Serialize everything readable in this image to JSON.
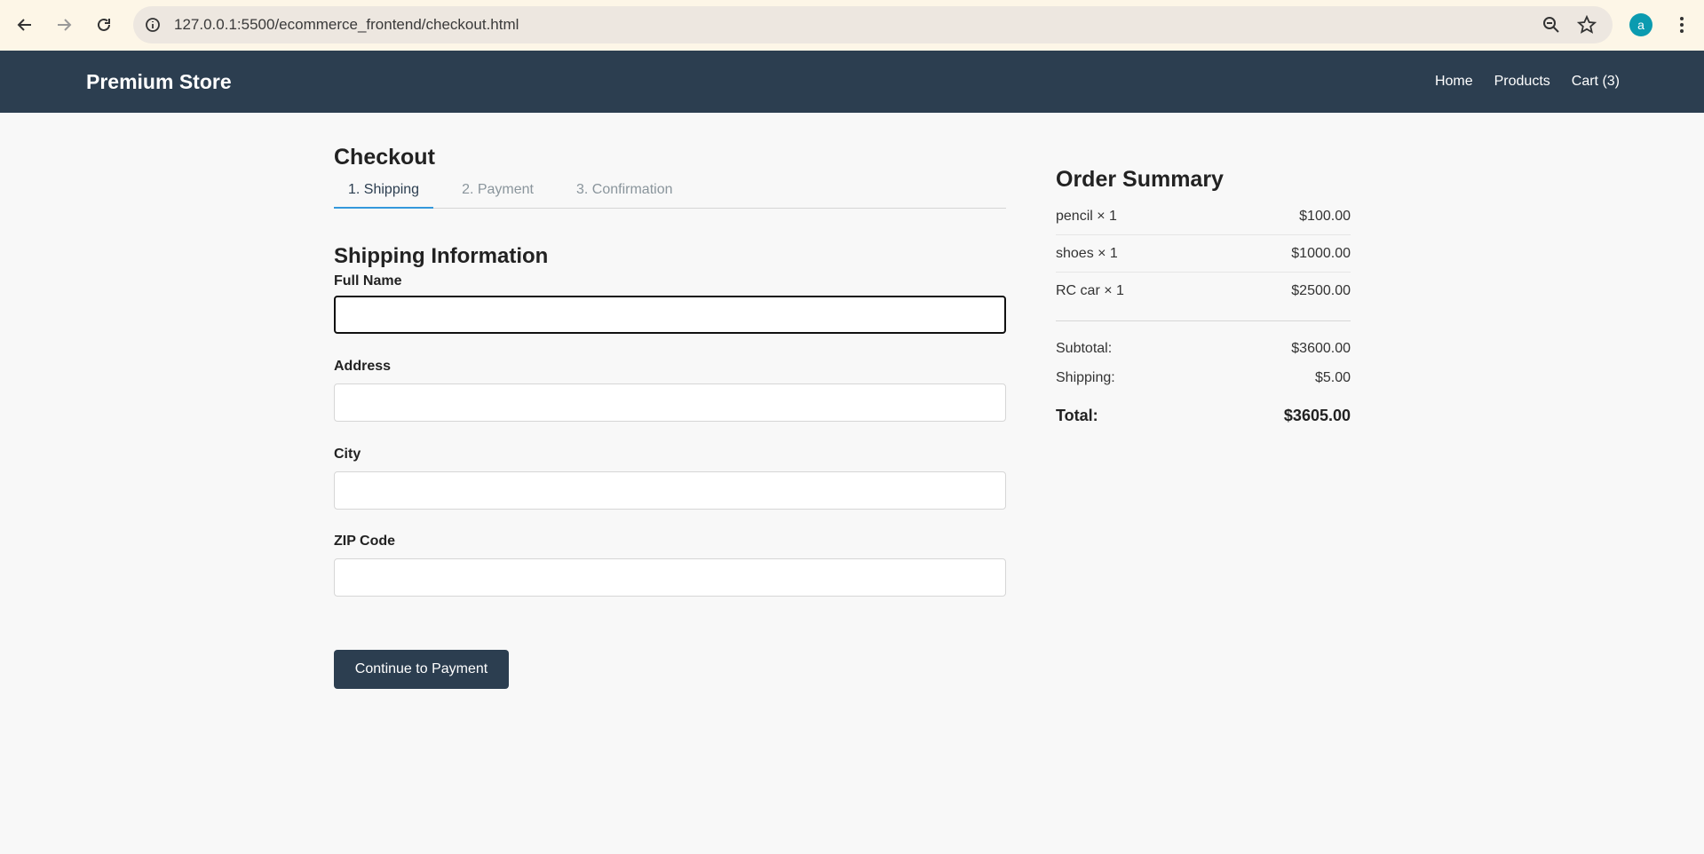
{
  "browser": {
    "url": "127.0.0.1:5500/ecommerce_frontend/checkout.html",
    "profile_initial": "a",
    "icons": [
      "back-arrow-icon",
      "forward-arrow-icon",
      "reload-icon",
      "site-info-icon",
      "zoom-icon",
      "bookmark-star-icon",
      "more-vert-icon"
    ]
  },
  "header": {
    "brand": "Premium Store",
    "nav": {
      "home": "Home",
      "products": "Products",
      "cart": "Cart (3)"
    }
  },
  "checkout": {
    "title": "Checkout",
    "steps": {
      "shipping": "1. Shipping",
      "payment": "2. Payment",
      "confirmation": "3. Confirmation"
    },
    "section_title": "Shipping Information",
    "fields": {
      "full_name": {
        "label": "Full Name",
        "value": ""
      },
      "address": {
        "label": "Address",
        "value": ""
      },
      "city": {
        "label": "City",
        "value": ""
      },
      "zip": {
        "label": "ZIP Code",
        "value": ""
      }
    },
    "continue_label": "Continue to Payment"
  },
  "summary": {
    "title": "Order Summary",
    "items": [
      {
        "name": "pencil × 1",
        "price": "$100.00"
      },
      {
        "name": "shoes × 1",
        "price": "$1000.00"
      },
      {
        "name": "RC car × 1",
        "price": "$2500.00"
      }
    ],
    "subtotal_label": "Subtotal:",
    "subtotal_value": "$3600.00",
    "shipping_label": "Shipping:",
    "shipping_value": "$5.00",
    "total_label": "Total:",
    "total_value": "$3605.00"
  },
  "colors": {
    "header_bg": "#2c3e50",
    "accent": "#3498db",
    "button_bg": "#2c3e50"
  }
}
